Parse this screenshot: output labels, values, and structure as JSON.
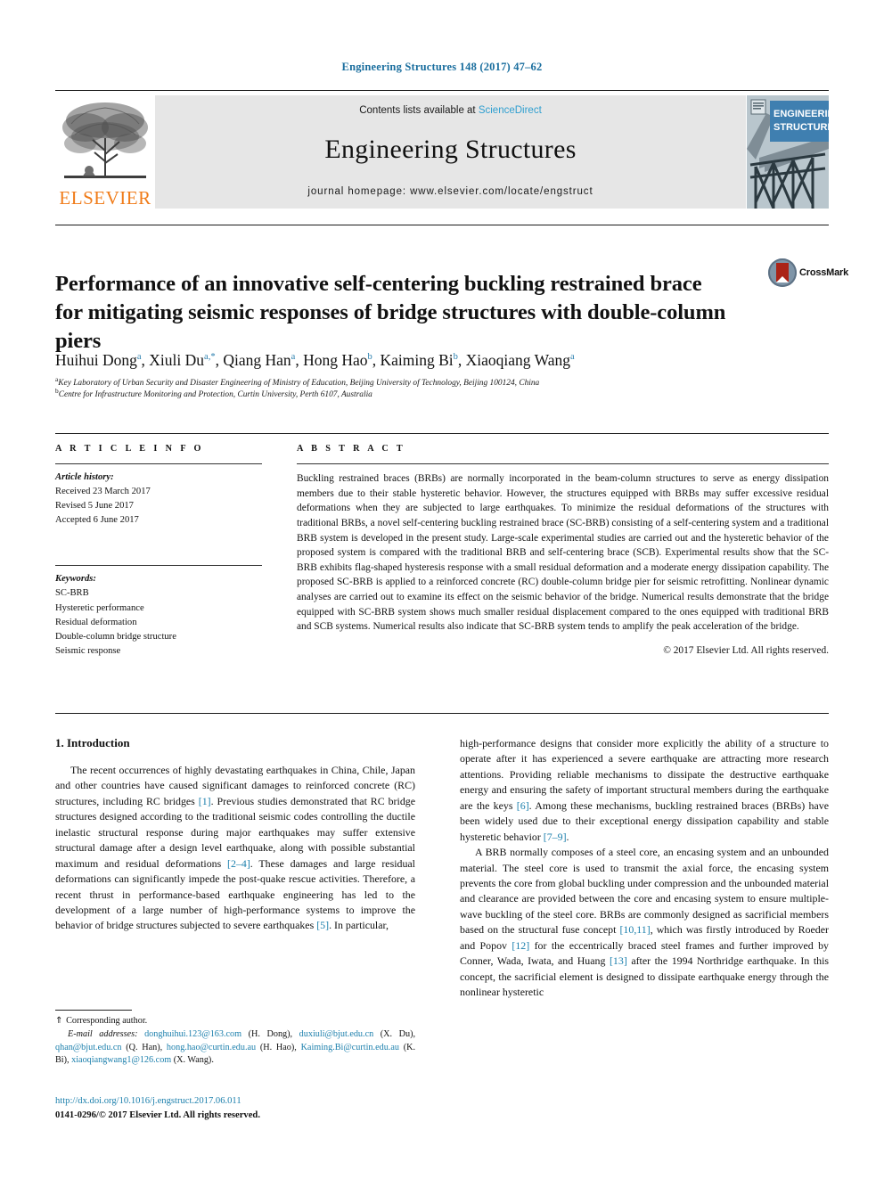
{
  "running_head": "Engineering Structures 148 (2017) 47–62",
  "masthead": {
    "contents_prefix": "Contents lists available at ",
    "sciencedirect": "ScienceDirect",
    "journal_name": "Engineering Structures",
    "homepage": "journal homepage: www.elsevier.com/locate/engstruct",
    "publisher": "ELSEVIER",
    "cover_title_line1": "ENGINEERING",
    "cover_title_line2": "STRUCTURES",
    "sciencedirect_color": "#2f9fd0",
    "publisher_color": "#f07c1a",
    "banner_bg": "#e6e6e6"
  },
  "crossmark": {
    "label": "CrossMark",
    "badge_color": "#7f95a8",
    "book_color": "#ab2317"
  },
  "article": {
    "title": "Performance of an innovative self-centering buckling restrained brace for mitigating seismic responses of bridge structures with double-column piers",
    "authors_html": "Huihui Dong<sup>a</sup>, Xiuli Du<sup>a,*</sup>, Qiang Han<sup>a</sup>, Hong Hao<sup>b</sup>, Kaiming Bi<sup>b</sup>, Xiaoqiang Wang<sup>a</sup>",
    "affiliation_a": "Key Laboratory of Urban Security and Disaster Engineering of Ministry of Education, Beijing University of Technology, Beijing 100124, China",
    "affiliation_b": "Centre for Infrastructure Monitoring and Protection, Curtin University, Perth 6107, Australia"
  },
  "info": {
    "heading": "A R T I C L E   I N F O",
    "history_label": "Article history:",
    "history": [
      "Received 23 March 2017",
      "Revised 5 June 2017",
      "Accepted 6 June 2017"
    ],
    "keywords_label": "Keywords:",
    "keywords": [
      "SC-BRB",
      "Hysteretic performance",
      "Residual deformation",
      "Double-column bridge structure",
      "Seismic response"
    ]
  },
  "abstract": {
    "heading": "A B S T R A C T",
    "text": "Buckling restrained braces (BRBs) are normally incorporated in the beam-column structures to serve as energy dissipation members due to their stable hysteretic behavior. However, the structures equipped with BRBs may suffer excessive residual deformations when they are subjected to large earthquakes. To minimize the residual deformations of the structures with traditional BRBs, a novel self-centering buckling restrained brace (SC-BRB) consisting of a self-centering system and a traditional BRB system is developed in the present study. Large-scale experimental studies are carried out and the hysteretic behavior of the proposed system is compared with the traditional BRB and self-centering brace (SCB). Experimental results show that the SC-BRB exhibits flag-shaped hysteresis response with a small residual deformation and a moderate energy dissipation capability. The proposed SC-BRB is applied to a reinforced concrete (RC) double-column bridge pier for seismic retrofitting. Nonlinear dynamic analyses are carried out to examine its effect on the seismic behavior of the bridge. Numerical results demonstrate that the bridge equipped with SC-BRB system shows much smaller residual displacement compared to the ones equipped with traditional BRB and SCB systems. Numerical results also indicate that SC-BRB system tends to amplify the peak acceleration of the bridge.",
    "copyright": "© 2017 Elsevier Ltd. All rights reserved."
  },
  "body": {
    "section_heading": "1. Introduction",
    "left_para_1_a": "The recent occurrences of highly devastating earthquakes in China, Chile, Japan and other countries have caused significant damages to reinforced concrete (RC) structures, including RC bridges ",
    "left_cite_1": "[1]",
    "left_para_1_b": ". Previous studies demonstrated that RC bridge structures designed according to the traditional seismic codes controlling the ductile inelastic structural response during major earthquakes may suffer extensive structural damage after a design level earthquake, along with possible substantial maximum and residual deformations ",
    "left_cite_2": "[2–4]",
    "left_para_1_c": ". These damages and large residual deformations can significantly impede the post-quake rescue activities. Therefore, a recent thrust in performance-based earthquake engineering has led to the development of a large number of high-performance systems to improve the behavior of bridge structures subjected to severe earthquakes ",
    "left_cite_3": "[5]",
    "left_para_1_d": ". In particular,",
    "right_para_1_a": "high-performance designs that consider more explicitly the ability of a structure to operate after it has experienced a severe earthquake are attracting more research attentions. Providing reliable mechanisms to dissipate the destructive earthquake energy and ensuring the safety of important structural members during the earthquake are the keys ",
    "right_cite_1": "[6]",
    "right_para_1_b": ". Among these mechanisms, buckling restrained braces (BRBs) have been widely used due to their exceptional energy dissipation capability and stable hysteretic behavior ",
    "right_cite_2": "[7–9]",
    "right_para_1_c": ".",
    "right_para_2_a": "A BRB normally composes of a steel core, an encasing system and an unbounded material. The steel core is used to transmit the axial force, the encasing system prevents the core from global buckling under compression and the unbounded material and clearance are provided between the core and encasing system to ensure multiple-wave buckling of the steel core. BRBs are commonly designed as sacrificial members based on the structural fuse concept ",
    "right_cite_3": "[10,11]",
    "right_para_2_b": ", which was firstly introduced by Roeder and Popov ",
    "right_cite_4": "[12]",
    "right_para_2_c": " for the eccentrically braced steel frames and further improved by Conner, Wada, Iwata, and Huang ",
    "right_cite_5": "[13]",
    "right_para_2_d": " after the 1994 Northridge earthquake. In this concept, the sacrificial element is designed to dissipate earthquake energy through the nonlinear hysteretic"
  },
  "footnotes": {
    "corresponding_marker": "⇑",
    "corresponding_text": " Corresponding author.",
    "email_label": "E-mail addresses:",
    "emails": [
      {
        "address": "donghuihui.123@163.com",
        "person": " (H. Dong), "
      },
      {
        "address": "duxiuli@bjut.edu.cn",
        "person": " (X. Du), "
      },
      {
        "address": "qhan@bjut.edu.cn",
        "person": " (Q. Han), "
      },
      {
        "address": "hong.hao@curtin.edu.au",
        "person": " (H. Hao), "
      },
      {
        "address": "Kaiming.Bi@curtin.edu.au",
        "person": " (K. Bi), "
      },
      {
        "address": "xiaoqiangwang1@126.com",
        "person": " (X. Wang)."
      }
    ],
    "doi": "http://dx.doi.org/10.1016/j.engstruct.2017.06.011",
    "issn_line": "0141-0296/© 2017 Elsevier Ltd. All rights reserved."
  }
}
